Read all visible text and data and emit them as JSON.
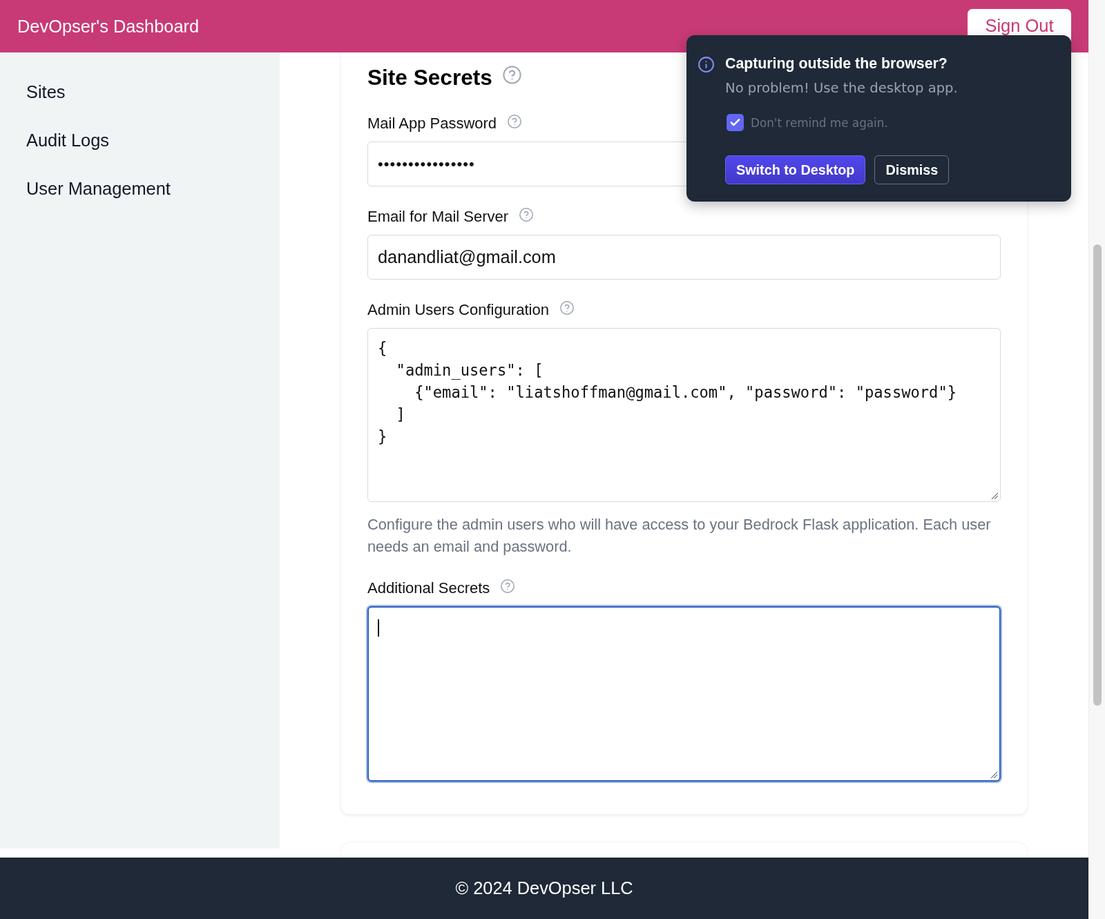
{
  "header": {
    "title": "DevOpser's Dashboard",
    "sign_out_button": "Sign Out"
  },
  "sidebar": {
    "items": [
      {
        "label": "Sites",
        "selected": false
      },
      {
        "label": "Audit Logs",
        "selected": false
      },
      {
        "label": "User Management",
        "selected": false
      }
    ]
  },
  "form": {
    "title": "Site Secrets",
    "fields": [
      {
        "kind": "password",
        "label": "Mail App Password",
        "value": "••••••••••••••••",
        "focused": false
      },
      {
        "kind": "text",
        "label": "Email for Mail Server",
        "value": "danandliat@gmail.com",
        "focused": false
      },
      {
        "kind": "code",
        "label": "Admin Users Configuration",
        "value": "{\n  \"admin_users\": [\n    {\"email\": \"liatshoffman@gmail.com\", \"password\": \"password\"}\n  ]\n}",
        "help_text": "Configure the admin users who will have access to your Bedrock Flask application. Each user needs an email and password.",
        "focused": false
      },
      {
        "kind": "textarea",
        "label": "Additional Secrets",
        "focused": true
      }
    ]
  },
  "popup": {
    "title": "Capturing outside the browser?",
    "message": "No problem! Use the desktop app.",
    "checkbox": {
      "label": "Don't remind me again.",
      "checked": true
    },
    "buttons": [
      {
        "label": "Switch to Desktop",
        "kind": "primary"
      },
      {
        "label": "Dismiss",
        "kind": "secondary"
      }
    ]
  },
  "footer": {
    "text": "© 2024 DevOpser LLC"
  }
}
